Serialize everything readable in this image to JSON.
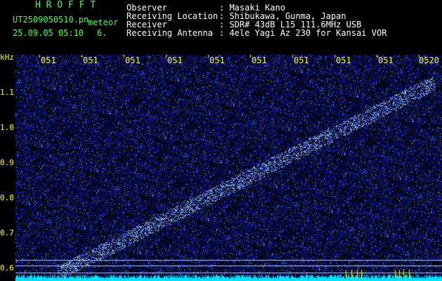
{
  "header": {
    "app_title": "H R O F F T",
    "filename": "UT2509050510.pn",
    "suffix": "meteor",
    "datetime": "25.09.05 05:10",
    "channel": "6.",
    "fields": [
      {
        "label": "Observer",
        "value": ": Masaki Kano"
      },
      {
        "label": "Receiving Location",
        "value": ": Shibukawa, Gunma, Japan"
      },
      {
        "label": "Receiver",
        "value": ": SDR# 43dB L15 111.6MHz USB"
      },
      {
        "label": "Receiving Antenna",
        "value": ": 4ele Yagi Az 230 for Kansai VOR"
      }
    ]
  },
  "axis": {
    "unit": "kHz",
    "yticks": [
      "1.1",
      "1.0",
      "0.9",
      "0.8",
      "0.7",
      "0.6"
    ],
    "minute_labels": [
      "051",
      "051",
      "051",
      "051",
      "051",
      "051",
      "051",
      "051",
      "051",
      "0520"
    ]
  },
  "colors": {
    "background": "#000000",
    "noise": "#1a2cff",
    "signal": "#9fd0ff",
    "green_text": "#4cff4c",
    "label_yellow": "#ffff00",
    "baseline": "#00e0ff"
  }
}
